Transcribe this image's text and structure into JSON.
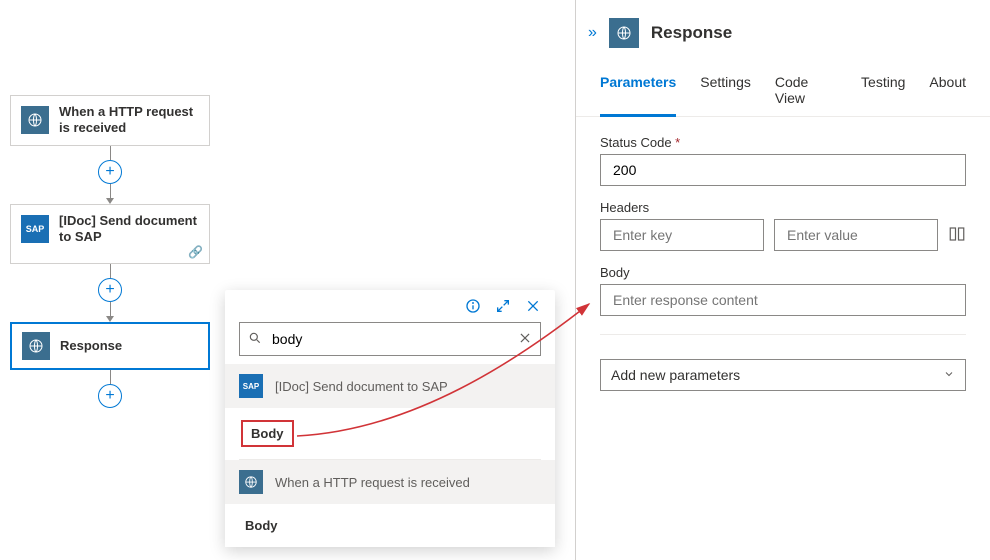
{
  "flow": {
    "step1_label": "When a HTTP request is received",
    "step2_label": "[IDoc] Send document to SAP",
    "step3_label": "Response",
    "sap_badge": "SAP"
  },
  "popup": {
    "search_value": "body",
    "group1_label": "[IDoc] Send document to SAP",
    "token1": "Body",
    "group2_label": "When a HTTP request is received",
    "token2": "Body"
  },
  "panel": {
    "title": "Response",
    "tabs": {
      "parameters": "Parameters",
      "settings": "Settings",
      "code_view": "Code View",
      "testing": "Testing",
      "about": "About"
    },
    "status_label": "Status Code",
    "status_value": "200",
    "headers_label": "Headers",
    "headers_key_placeholder": "Enter key",
    "headers_value_placeholder": "Enter value",
    "body_label": "Body",
    "body_placeholder": "Enter response content",
    "add_params": "Add new parameters"
  }
}
